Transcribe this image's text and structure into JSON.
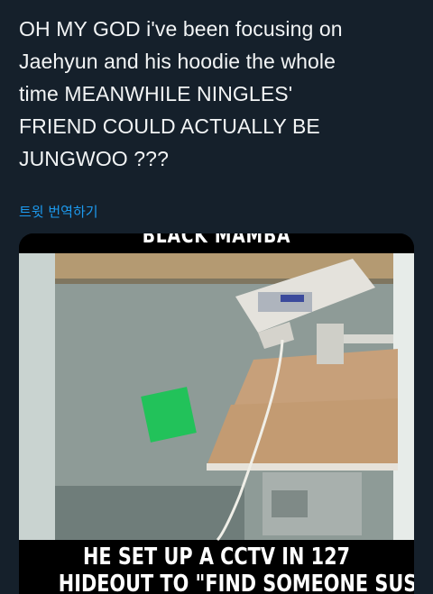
{
  "tweet": {
    "text_lines": [
      "OH MY GOD i've been focusing on",
      "Jaehyun and his hoodie the whole",
      "time MEANWHILE NINGLES'",
      "FRIEND COULD ACTUALLY BE",
      "JUNGWOO ???"
    ],
    "translate_label": "트윗 번역하기"
  },
  "media": {
    "top_caption": "BLACK MAMBA",
    "bottom_caption_lines": [
      "HE SET UP A CCTV IN 127",
      "HIDEOUT TO \"FIND SOMEONE SUS\""
    ]
  },
  "colors": {
    "background": "#15202b",
    "text": "#f2f4f5",
    "link": "#1d9bf0"
  }
}
